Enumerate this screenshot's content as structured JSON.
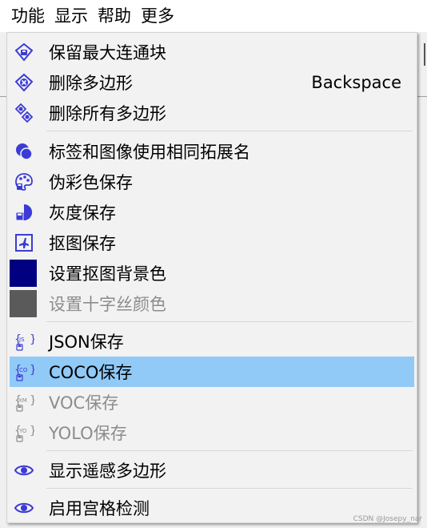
{
  "menubar": {
    "items": [
      {
        "label": "功能"
      },
      {
        "label": "显示"
      },
      {
        "label": "帮助"
      },
      {
        "label": "更多"
      }
    ]
  },
  "menu": {
    "items": [
      {
        "label": "保留最大连通块",
        "icon": "polygon-keep-icon"
      },
      {
        "label": "删除多边形",
        "shortcut": "Backspace",
        "icon": "polygon-delete-icon"
      },
      {
        "label": "删除所有多边形",
        "icon": "polygon-delete-all-icon"
      },
      {
        "label": "标签和图像使用相同拓展名",
        "icon": "same-extension-icon"
      },
      {
        "label": "伪彩色保存",
        "icon": "palette-save-icon"
      },
      {
        "label": "灰度保存",
        "icon": "grayscale-save-icon"
      },
      {
        "label": "抠图保存",
        "icon": "cutout-save-icon"
      },
      {
        "label": "设置抠图背景色",
        "icon": "background-color-swatch"
      },
      {
        "label": "设置十字丝颜色",
        "icon": "crosshair-color-swatch"
      },
      {
        "label": "JSON保存",
        "icon": "json-save-icon"
      },
      {
        "label": "COCO保存",
        "icon": "coco-save-icon"
      },
      {
        "label": "VOC保存",
        "icon": "voc-save-icon"
      },
      {
        "label": "YOLO保存",
        "icon": "yolo-save-icon"
      },
      {
        "label": "显示遥感多边形",
        "icon": "eye-icon"
      },
      {
        "label": "启用宫格检测",
        "icon": "eye-icon"
      }
    ],
    "icon_tags": {
      "json": "JS",
      "coco": "CO",
      "voc": "XM",
      "yolo": "YO"
    }
  },
  "colors": {
    "icon_blue": "#3b3bd6",
    "highlight": "#91c9f7",
    "bg_swatch": "#000080",
    "crosshair_swatch": "#5a5a5a",
    "disabled_text": "#8c8c8c"
  },
  "watermark": "CSDN @Josepy_nar"
}
